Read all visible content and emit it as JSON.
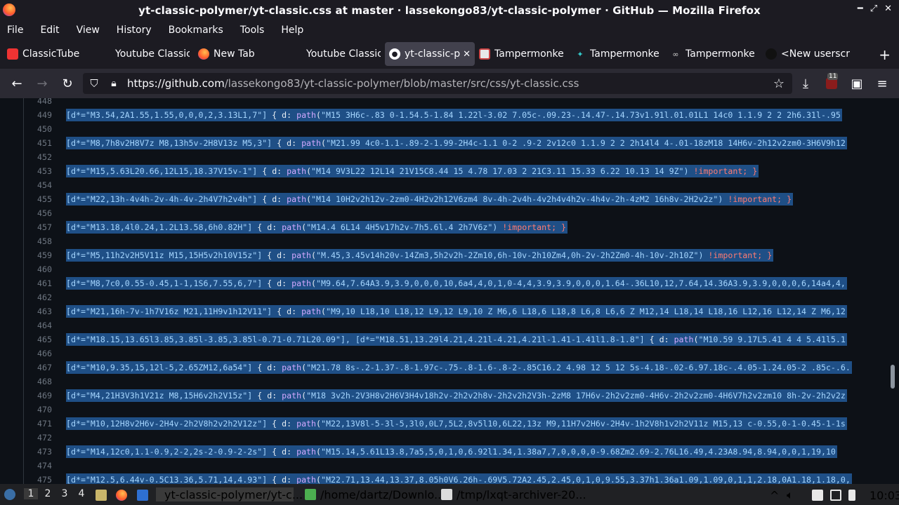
{
  "window": {
    "title": "yt-classic-polymer/yt-classic.css at master · lassekongo83/yt-classic-polymer · GitHub — Mozilla Firefox"
  },
  "menu": [
    "File",
    "Edit",
    "View",
    "History",
    "Bookmarks",
    "Tools",
    "Help"
  ],
  "tabs": [
    {
      "label": "ClassicTube",
      "icon": "classictube-icon"
    },
    {
      "label": "Youtube Classic P",
      "icon": "none"
    },
    {
      "label": "New Tab",
      "icon": "firefox-icon"
    },
    {
      "label": "Youtube Classic P",
      "icon": "none"
    },
    {
      "label": "yt-classic-pc",
      "icon": "github-icon",
      "active": true
    },
    {
      "label": "Tampermonke",
      "icon": "tampermonkey-icon"
    },
    {
      "label": "Tampermonke",
      "icon": "bug-icon"
    },
    {
      "label": "Tampermonke",
      "icon": "glasses-icon"
    },
    {
      "label": "<New userscr",
      "icon": "spy-icon"
    }
  ],
  "nav": {
    "url_host": "https://github.com",
    "url_path": "/lassekongo83/yt-classic-polymer/blob/master/src/css/yt-classic.css",
    "badge_count": "11"
  },
  "code": [
    {
      "n": "448",
      "text": ""
    },
    {
      "n": "449",
      "sel": "[d*=\"M3.54,2A1.55,1.55,0,0,0,2,3.13L1,7\"]",
      "path": "\"M15 3H6c-.83 0-1.54.5-1.84 1.22l-3.02 7.05c-.09.23-.14.47-.14.73v1.91l.01.01L1 14c0 1.1.9 2 2 2h6.31l-.95",
      "imp": ""
    },
    {
      "n": "450",
      "text": ""
    },
    {
      "n": "451",
      "sel": "[d*=\"M8,7h8v2H8V7z M8,13h5v-2H8V13z M5,3\"]",
      "path": "\"M21.99 4c0-1.1-.89-2-1.99-2H4c-1.1 0-2 .9-2 2v12c0 1.1.9 2 2 2h14l4 4-.01-18zM18 14H6v-2h12v2zm0-3H6V9h12",
      "imp": ""
    },
    {
      "n": "452",
      "text": ""
    },
    {
      "n": "453",
      "sel": "[d*=\"M15,5.63L20.66,12L15,18.37V15v-1\"]",
      "path": "\"M14 9V3L22 12L14 21V15C8.44 15 4.78 17.03 2 21C3.11 15.33 6.22 10.13 14 9Z\")",
      "imp": " !important; }"
    },
    {
      "n": "454",
      "text": ""
    },
    {
      "n": "455",
      "sel": "[d*=\"M22,13h-4v4h-2v-4h-4v-2h4V7h2v4h\"]",
      "path": "\"M14 10H2v2h12v-2zm0-4H2v2h12V6zm4 8v-4h-2v4h-4v2h4v4h2v-4h4v-2h-4zM2 16h8v-2H2v2z\")",
      "imp": " !important; }"
    },
    {
      "n": "456",
      "text": ""
    },
    {
      "n": "457",
      "sel": "[d*=\"M13.18,4l0.24,1.2L13.58,6h0.82H\"]",
      "path": "\"M14.4 6L14 4H5v17h2v-7h5.6l.4 2h7V6z\")",
      "imp": " !important; }"
    },
    {
      "n": "458",
      "text": ""
    },
    {
      "n": "459",
      "sel": "[d*=\"M5,11h2v2H5V11z M15,15H5v2h10V15z\"]",
      "path": "\"M.45,3.45v14h20v-14Zm3,5h2v2h-2Zm10,6h-10v-2h10Zm4,0h-2v-2h2Zm0-4h-10v-2h10Z\")",
      "imp": " !important; }"
    },
    {
      "n": "460",
      "text": ""
    },
    {
      "n": "461",
      "sel": "[d*=\"M8,7c0,0.55-0.45,1-1,1S6,7.55,6,7\"]",
      "path": "\"M9.64,7.64A3.9,3.9,0,0,0,10,6a4,4,0,1,0-4,4,3.9,3.9,0,0,0,1.64-.36L10,12,7.64,14.36A3.9,3.9,0,0,0,6,14a4,4,",
      "imp": ""
    },
    {
      "n": "462",
      "text": ""
    },
    {
      "n": "463",
      "sel": "[d*=\"M21,16h-7v-1h7V16z M21,11H9v1h12V11\"]",
      "path": "\"M9,10 L18,10 L18,12 L9,12 L9,10 Z M6,6 L18,6 L18,8 L6,8 L6,6 Z M12,14 L18,14 L18,16 L12,16 L12,14 Z M6,12",
      "imp": ""
    },
    {
      "n": "464",
      "text": ""
    },
    {
      "n": "465",
      "sel": "[d*=\"M18.15,13.65l3.85,3.85l-3.85,3.85l-0.71-0.71L20.09\"], [d*=\"M18.51,13.29l4.21,4.21l-4.21,4.21l-1.41-1.41l1.8-1.8\"]",
      "path": "\"M10.59 9.17L5.41 4 4 5.41l5.1",
      "imp": ""
    },
    {
      "n": "466",
      "text": ""
    },
    {
      "n": "467",
      "sel": "[d*=\"M10,9.35,15,12l-5,2.65ZM12,6a54\"]",
      "path": "\"M21.78 8s-.2-1.37-.8-1.97c-.75-.8-1.6-.8-2-.85C16.2 4.98 12 5 12 5s-4.18-.02-6.97.18c-.4.05-1.24.05-2 .85c-.6.",
      "imp": ""
    },
    {
      "n": "468",
      "text": ""
    },
    {
      "n": "469",
      "sel": "[d*=\"M4,21H3V3h1V21z M8,15H6v2h2V15z\"]",
      "path": "\"M18 3v2h-2V3H8v2H6V3H4v18h2v-2h2v2h8v-2h2v2h2V3h-2zM8 17H6v-2h2v2zm0-4H6v-2h2v2zm0-4H6V7h2v2zm10 8h-2v-2h2v2z",
      "imp": ""
    },
    {
      "n": "470",
      "text": ""
    },
    {
      "n": "471",
      "sel": "[d*=\"M10,12H8v2H6v-2H4v-2h2V8h2v2h2V12z\"]",
      "path": "\"M22,13V8l-5-3l-5,3l0,0L7,5L2,8v5l10,6L22,13z M9,11H7v2H6v-2H4v-1h2V8h1v2h2V11z M15,13 c-0.55,0-1-0.45-1-1s",
      "imp": ""
    },
    {
      "n": "472",
      "text": ""
    },
    {
      "n": "473",
      "sel": "[d*=\"M14,12c0,1.1-0.9,2-2,2s-2-0.9-2-2s\"]",
      "path": "\"M15.14,5.61L13.8,7a5,5,0,1,0,6.92l1.34,1.38a7,7,0,0,0,0-9.68Zm2.69-2.76L16.49,4.23A8.94,8.94,0,0,1,19,10",
      "imp": ""
    },
    {
      "n": "474",
      "text": ""
    },
    {
      "n": "475",
      "sel": "[d*=\"M12.5,6.44v-0.5C13.36,5.71,14,4.93\"]",
      "path": "\"M22.71,13.44,13.37,8.05h0V6.26h-.69V5.72A2.45,2.45,0,1,0,9.55,3.37h1.36a1.09,1.09,0,1,1,2.18,0A1.18,1.18,0,",
      "imp": ""
    }
  ],
  "keywords": {
    "d": "d",
    "path": "path"
  },
  "taskbar": {
    "workspaces": [
      "1",
      "2",
      "3",
      "4"
    ],
    "items": [
      {
        "label": "yt-classic-polymer/yt-c...",
        "icon": "firefox-icon"
      },
      {
        "label": "/home/dartz/Downlo...",
        "icon": "file-manager-icon"
      },
      {
        "label": "/tmp/lxqt-archiver-20...",
        "icon": "editor-icon"
      }
    ],
    "clock": "10:03"
  }
}
